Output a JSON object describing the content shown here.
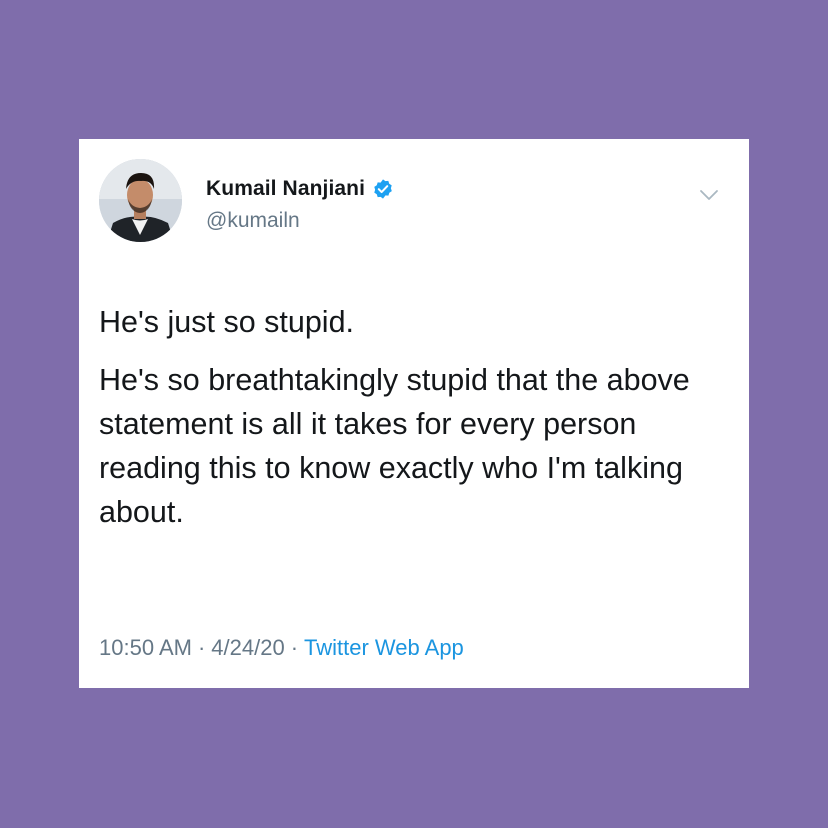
{
  "colors": {
    "background": "#7f6dab",
    "card": "#ffffff",
    "text": "#14171a",
    "muted": "#657786",
    "link": "#1b95e0",
    "verified": "#1da1f2"
  },
  "tweet": {
    "author": {
      "display_name": "Kumail Nanjiani",
      "handle": "@kumailn",
      "verified": true,
      "avatar_icon": "profile-photo",
      "verified_icon": "verified-badge-icon"
    },
    "menu_icon": "chevron-down-icon",
    "paragraphs": [
      "He's just so stupid.",
      "He's so breathtakingly stupid that the above statement is all it takes for every person reading this to know exactly who I'm talking about."
    ],
    "time": "10:50 AM",
    "date": "4/24/20",
    "separator": "·",
    "source": "Twitter Web App"
  }
}
